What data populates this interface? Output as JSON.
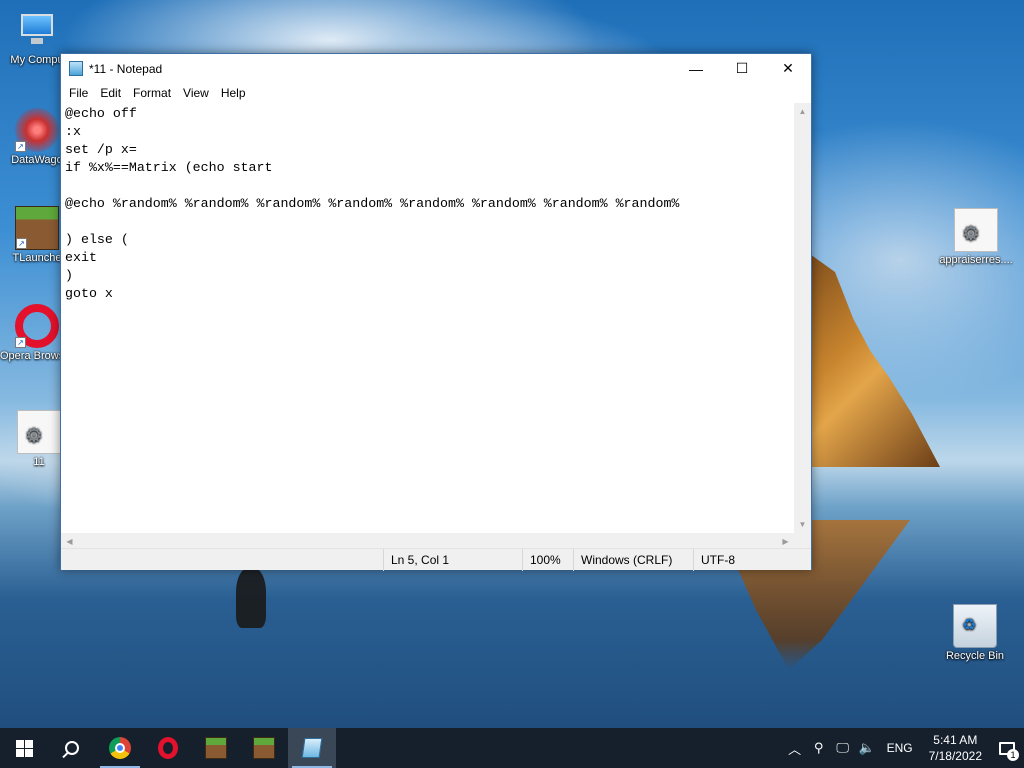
{
  "desktop": {
    "icons": [
      {
        "label": "My Compu",
        "icon": "computer-icon"
      },
      {
        "label": "DataWago",
        "icon": "datawago-icon"
      },
      {
        "label": "TLaunche",
        "icon": "minecraft-icon"
      },
      {
        "label": "Opera Browser",
        "icon": "opera-icon"
      },
      {
        "label": "11",
        "icon": "batch-file-icon"
      },
      {
        "label": "appraiserres....",
        "icon": "settings-file-icon"
      },
      {
        "label": "Recycle Bin",
        "icon": "recycle-bin-icon"
      }
    ]
  },
  "notepad": {
    "title": "*11 - Notepad",
    "controls": {
      "minimize": "—",
      "maximize": "☐",
      "close": "✕"
    },
    "menu": [
      "File",
      "Edit",
      "Format",
      "View",
      "Help"
    ],
    "content": "@echo off\n:x\nset /p x=\nif %x%==Matrix (echo start\n\n@echo %random% %random% %random% %random% %random% %random% %random% %random%\n\n) else (\nexit\n)\ngoto x",
    "scroll": {
      "up": "▲",
      "down": "▼",
      "left": "◀",
      "right": "▶"
    },
    "status": {
      "position": "Ln 5, Col 1",
      "zoom": "100%",
      "line_ending": "Windows (CRLF)",
      "encoding": "UTF-8"
    }
  },
  "taskbar": {
    "apps": [
      {
        "name": "chrome-icon",
        "running": true
      },
      {
        "name": "opera-icon",
        "running": false
      },
      {
        "name": "minecraft-icon",
        "running": false
      },
      {
        "name": "minecraft-icon",
        "running": false
      },
      {
        "name": "notepad-icon",
        "running": true,
        "active": true
      }
    ],
    "tray": {
      "chevron": "︿",
      "people": "⚲",
      "network": "🖵",
      "volume": "🔈",
      "language": "ENG",
      "time": "5:41 AM",
      "date": "7/18/2022",
      "notifications": "1"
    }
  },
  "colors": {
    "taskbar_bg": "#16202c",
    "window_border": "#3f6fa8",
    "statusbar_bg": "#f0f0f0"
  }
}
